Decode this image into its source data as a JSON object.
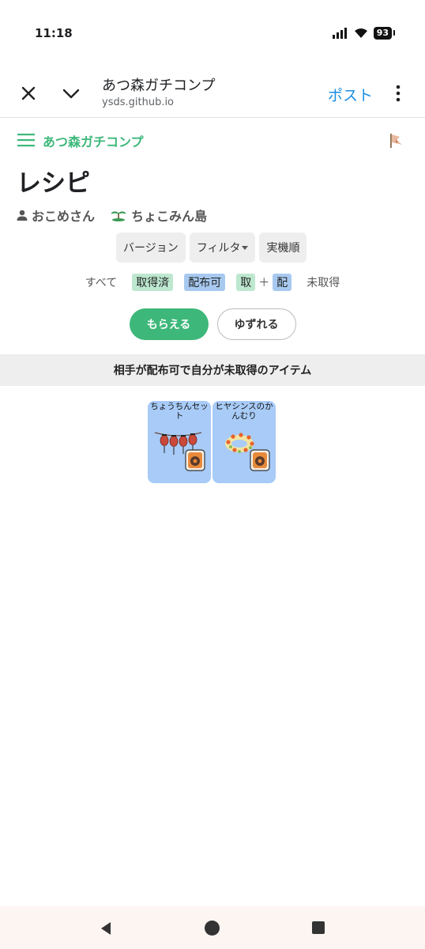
{
  "status_bar": {
    "time": "11:18",
    "battery": "93"
  },
  "browser": {
    "title": "あつ森ガチコンプ",
    "url": "ysds.github.io",
    "post_label": "ポスト"
  },
  "app": {
    "brand": "あつ森ガチコンプ",
    "page_title": "レシピ",
    "user_name": "おこめさん",
    "island_name": "ちょこみん島"
  },
  "toolbar": {
    "version_label": "バージョン",
    "filter_label": "フィルタ",
    "sort_label": "実機順"
  },
  "status_filter": {
    "all": "すべて",
    "owned": "取得済",
    "tradeable": "配布可",
    "combo_owned": "取",
    "combo_plus": "＋",
    "combo_trade": "配",
    "missing": "未取得"
  },
  "modes": {
    "receive": "もらえる",
    "give": "ゆずれる"
  },
  "section": {
    "title": "相手が配布可で自分が未取得のアイテム"
  },
  "items": [
    {
      "name": "ちょうちんセット"
    },
    {
      "name": "ヒヤシンスのかんむり"
    }
  ],
  "colors": {
    "accent": "#3db87a",
    "card": "#a8cbf7",
    "link": "#1a8fe3"
  }
}
